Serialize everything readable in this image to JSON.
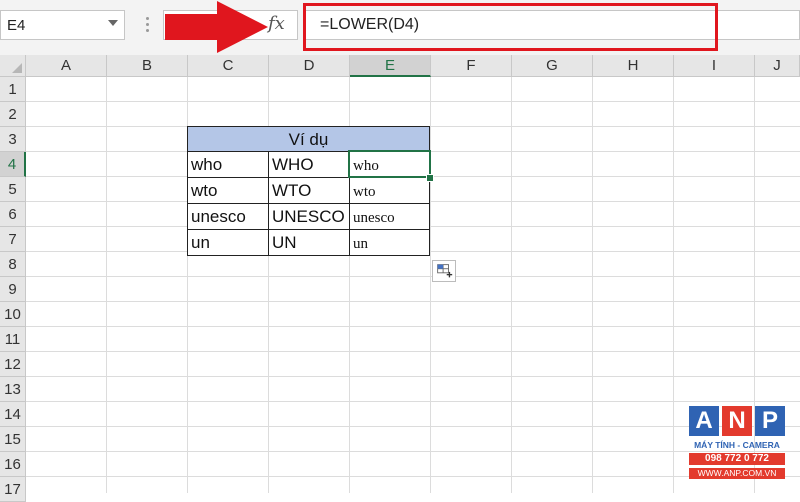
{
  "formula_bar": {
    "name_box": "E4",
    "fx_icon": "fx-icon",
    "formula": "=LOWER(D4)"
  },
  "columns": [
    "A",
    "B",
    "C",
    "D",
    "E",
    "F",
    "G",
    "H",
    "I",
    "J"
  ],
  "rows": [
    "1",
    "2",
    "3",
    "4",
    "5",
    "6",
    "7",
    "8",
    "9",
    "10",
    "11",
    "12",
    "13",
    "14",
    "15",
    "16",
    "17"
  ],
  "active_cell": "E4",
  "table": {
    "header": "Ví dụ",
    "rows": [
      [
        "who",
        "WHO",
        "who"
      ],
      [
        "wto",
        "WTO",
        "wto"
      ],
      [
        "unesco",
        "UNESCO",
        "unesco"
      ],
      [
        "un",
        "UN",
        "un"
      ]
    ]
  },
  "logo": {
    "letters": [
      "A",
      "N",
      "P"
    ],
    "tagline": "MÁY TÍNH - CAMERA",
    "phone": "098 772 0 772",
    "website": "WWW.ANP.COM.VN"
  },
  "colors": {
    "accent": "#217346",
    "header_fill": "#b4c6e7",
    "annotation": "#e0161e"
  }
}
